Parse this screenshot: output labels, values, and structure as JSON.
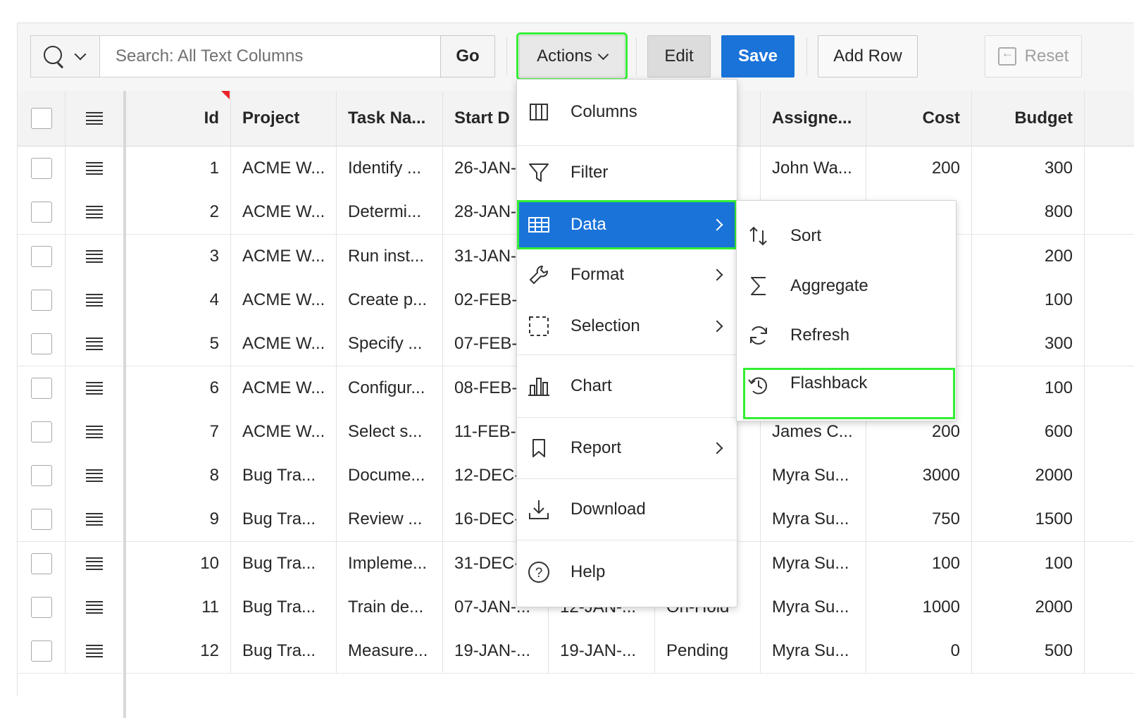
{
  "toolbar": {
    "search_placeholder": "Search: All Text Columns",
    "go_label": "Go",
    "actions_label": "Actions",
    "edit_label": "Edit",
    "save_label": "Save",
    "add_row_label": "Add Row",
    "reset_label": "Reset"
  },
  "grid": {
    "headers": [
      "Id",
      "Project",
      "Task Na...",
      "Start D",
      "",
      "",
      "Assigne...",
      "Cost",
      "Budget"
    ],
    "rows": [
      {
        "id": "1",
        "project": "ACME W...",
        "task": "Identify ...",
        "start": "26-JAN-",
        "end": "",
        "status": "",
        "assignee": "John Wa...",
        "cost": "200",
        "budget": "300"
      },
      {
        "id": "2",
        "project": "ACME W...",
        "task": "Determi...",
        "start": "28-JAN-",
        "end": "",
        "status": "",
        "assignee": "",
        "cost": "",
        "budget": "800"
      },
      {
        "id": "3",
        "project": "ACME W...",
        "task": "Run inst...",
        "start": "31-JAN-",
        "end": "",
        "status": "",
        "assignee": "",
        "cost": "",
        "budget": "200"
      },
      {
        "id": "4",
        "project": "ACME W...",
        "task": "Create p...",
        "start": "02-FEB-",
        "end": "",
        "status": "",
        "assignee": "",
        "cost": "",
        "budget": "100"
      },
      {
        "id": "5",
        "project": "ACME W...",
        "task": "Specify ...",
        "start": "07-FEB-",
        "end": "",
        "status": "",
        "assignee": "",
        "cost": "",
        "budget": "300"
      },
      {
        "id": "6",
        "project": "ACME W...",
        "task": "Configur...",
        "start": "08-FEB-",
        "end": "",
        "status": "",
        "assignee": "",
        "cost": "",
        "budget": "100"
      },
      {
        "id": "7",
        "project": "ACME W...",
        "task": "Select s...",
        "start": "11-FEB-",
        "end": "",
        "status": "",
        "assignee": "James C...",
        "cost": "200",
        "budget": "600"
      },
      {
        "id": "8",
        "project": "Bug Tra...",
        "task": "Docume...",
        "start": "12-DEC-",
        "end": "",
        "status": "",
        "assignee": "Myra Su...",
        "cost": "3000",
        "budget": "2000"
      },
      {
        "id": "9",
        "project": "Bug Tra...",
        "task": "Review ...",
        "start": "16-DEC-",
        "end": "",
        "status": "",
        "assignee": "Myra Su...",
        "cost": "750",
        "budget": "1500"
      },
      {
        "id": "10",
        "project": "Bug Tra...",
        "task": "Impleme...",
        "start": "31-DEC-",
        "end": "",
        "status": "",
        "assignee": "Myra Su...",
        "cost": "100",
        "budget": "100"
      },
      {
        "id": "11",
        "project": "Bug Tra...",
        "task": "Train de...",
        "start": "07-JAN-...",
        "end": "12-JAN-...",
        "status": "On-Hold",
        "assignee": "Myra Su...",
        "cost": "1000",
        "budget": "2000"
      },
      {
        "id": "12",
        "project": "Bug Tra...",
        "task": "Measure...",
        "start": "19-JAN-...",
        "end": "19-JAN-...",
        "status": "Pending",
        "assignee": "Myra Su...",
        "cost": "0",
        "budget": "500"
      }
    ]
  },
  "actions_menu": {
    "items": [
      {
        "label": "Columns",
        "icon": "columns-icon",
        "submenu": false
      },
      {
        "label": "Filter",
        "icon": "filter-icon",
        "submenu": false
      },
      {
        "label": "Data",
        "icon": "table-icon",
        "submenu": true,
        "active": true
      },
      {
        "label": "Format",
        "icon": "wrench-icon",
        "submenu": true
      },
      {
        "label": "Selection",
        "icon": "selection-icon",
        "submenu": true
      },
      {
        "label": "Chart",
        "icon": "chart-icon",
        "submenu": false
      },
      {
        "label": "Report",
        "icon": "bookmark-icon",
        "submenu": true
      },
      {
        "label": "Download",
        "icon": "download-icon",
        "submenu": false
      },
      {
        "label": "Help",
        "icon": "help-icon",
        "submenu": false
      }
    ]
  },
  "data_submenu": {
    "items": [
      {
        "label": "Sort",
        "icon": "sort-icon"
      },
      {
        "label": "Aggregate",
        "icon": "sigma-icon"
      },
      {
        "label": "Refresh",
        "icon": "refresh-icon"
      },
      {
        "label": "Flashback",
        "icon": "history-icon"
      }
    ]
  },
  "colors": {
    "accent": "#1a73d9",
    "highlight": "#33ee33",
    "flag": "#e8242a"
  }
}
